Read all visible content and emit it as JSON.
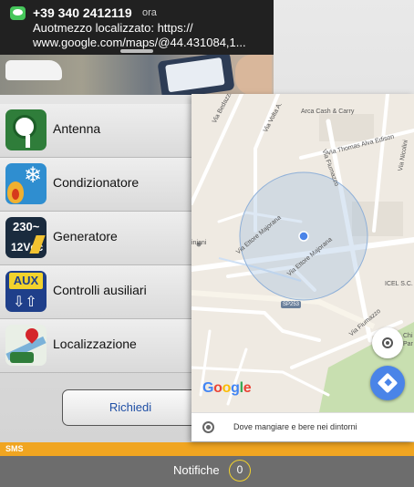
{
  "notification": {
    "sender": "+39 340 2412119",
    "time": "ora",
    "line1": "Auotmezzo localizzato: https://",
    "line2": "www.google.com/maps/@44.431084,1..."
  },
  "menu": {
    "items": [
      {
        "label": "Antenna",
        "icon": "antenna-icon"
      },
      {
        "label": "Condizionatore",
        "icon": "air-conditioner-icon"
      },
      {
        "label": "Generatore",
        "icon": "generator-icon",
        "icon_text_top": "230~",
        "icon_text_bottom": "12Vdc"
      },
      {
        "label": "Controlli ausiliari",
        "icon": "auxiliary-icon",
        "icon_text": "AUX"
      },
      {
        "label": "Localizzazione",
        "icon": "location-map-icon"
      }
    ]
  },
  "request_button": {
    "label": "Richiedi"
  },
  "sms_bar": {
    "label": "SMS"
  },
  "bottom_bar": {
    "notifications_label": "Notifiche",
    "notifications_count": "0"
  },
  "map": {
    "labels": {
      "via_bedazzo": "Via Bedazzo",
      "via_volta": "Via Volta A.",
      "arca": "Arca Cash & Carry",
      "via_edison": "Via Thomas Alva Edison",
      "via_fiumazzo_top": "Via Fiumazzo",
      "via_nicolini": "Via Nicolini",
      "miniani": "iniani",
      "via_majorana_1": "Via Ettore Majorana",
      "via_majorana_2": "Via Ettore Majorana",
      "icel": "ICEL S.C.",
      "sp253": "SP253",
      "via_fiumazzo_bottom": "Via Fiumazzo",
      "chi": "Chi",
      "par": "Par"
    },
    "google_logo": {
      "g1": "G",
      "o1": "o",
      "o2": "o",
      "g2": "g",
      "l": "l",
      "e": "e"
    },
    "explore_text": "Dove mangiare e bere nei dintorni"
  },
  "colors": {
    "accent_orange": "#f0a521",
    "bottom_bar": "#6d6d6d",
    "button_text_blue": "#1f4fa5",
    "map_fab_blue": "#4a84e8"
  }
}
